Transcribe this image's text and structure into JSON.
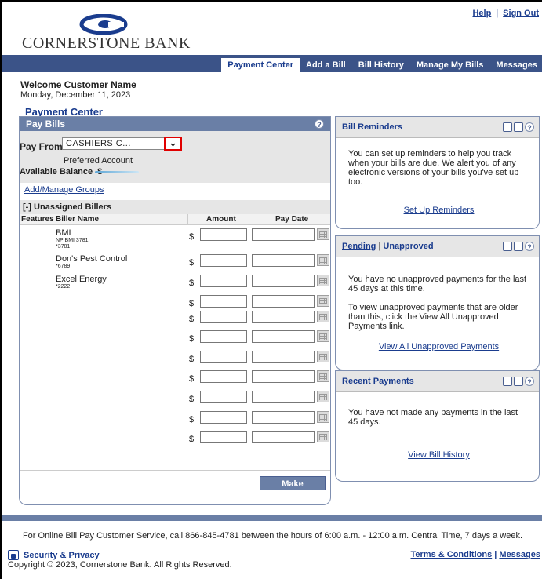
{
  "header": {
    "links": [
      "Help",
      "Sign Out"
    ],
    "logo_text": "CORNERSTONE BANK",
    "nav_tabs": [
      "Payment Center",
      "Add a Bill",
      "Bill History",
      "Manage My Bills",
      "Messages"
    ],
    "active_tab": "Payment Center"
  },
  "welcome": {
    "greeting": "Welcome Customer Name",
    "date": "Monday, December 11, 2023"
  },
  "page_title": "Payment Center",
  "pay_bills": {
    "title": "Pay Bills",
    "pay_from_label": "Pay From",
    "pay_from_value": "CASHIERS C...",
    "preferred": "Preferred Account",
    "available_balance_label": "Available Balance",
    "available_balance_symbol": "$",
    "add_manage_groups": "Add/Manage Groups",
    "group_header": "[-]  Unassigned Billers",
    "columns": [
      "Features",
      "Biller Name",
      "Amount",
      "Pay Date"
    ],
    "billers": [
      {
        "name": "BMI",
        "sub1": "NP BMI 3781",
        "sub2": "*3781"
      },
      {
        "name": "Don's Pest Control",
        "sub1": "*6789",
        "sub2": ""
      },
      {
        "name": "Excel Energy",
        "sub1": "*2222",
        "sub2": ""
      }
    ],
    "currency_symbol": "$",
    "make_payments": "Make Payments"
  },
  "widgets": {
    "reminders": {
      "title": "Bill Reminders",
      "text": "You can set up reminders to help you track when your bills are due. We alert you of any electronic versions of your bills you've set up too.",
      "link": "Set Up Reminders"
    },
    "pending": {
      "title_link": "Pending",
      "title_sep": " | ",
      "title_rest": "Unapproved",
      "text1": "You have no unapproved payments for the last 45 days at this time.",
      "text2": "To view unapproved payments that are older than this, click the View All Unapproved Payments link.",
      "link": "View All Unapproved Payments"
    },
    "recent": {
      "title": "Recent Payments",
      "text": "You have not made any payments in the last 45 days.",
      "link": "View Bill History"
    }
  },
  "footer": {
    "customer_service": "For Online Bill Pay Customer Service, call 866-845-4781 between the hours of 6:00 a.m. - 12:00 a.m. Central Time, 7 days a week.",
    "security": "Security & Privacy",
    "terms": "Terms & Conditions",
    "messages": "Messages",
    "terms_sep": " | ",
    "copyright": "Copyright © 2023, Cornerstone Bank. All Rights Reserved."
  },
  "colors": {
    "nav_bg": "#3b5388",
    "panel_header": "#6a7fa6",
    "link": "#1a3c8e",
    "highlight": "#e00000"
  }
}
